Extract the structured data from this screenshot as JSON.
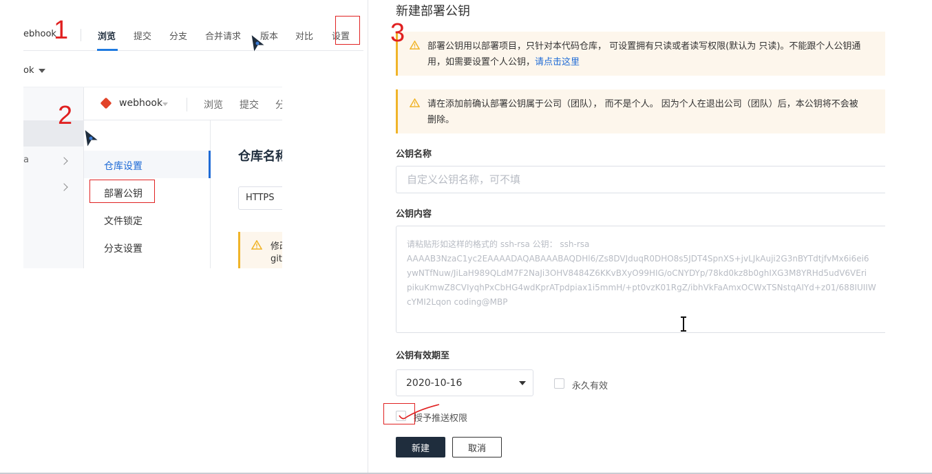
{
  "annotations": {
    "step1": "1",
    "step2": "2",
    "step3": "3"
  },
  "shot1": {
    "repo_partial": "ebhook",
    "tabs": [
      "浏览",
      "提交",
      "分支",
      "合并请求",
      "版本",
      "对比",
      "设置"
    ],
    "active_tab": "浏览",
    "repo_dropdown_partial": "ok"
  },
  "shot2": {
    "repo_name": "webhook",
    "top_tabs": [
      "浏览",
      "提交",
      "分"
    ],
    "left_partial": "a",
    "menu": [
      "仓库设置",
      "部署公钥",
      "文件锁定",
      "分支设置"
    ],
    "active_menu": "仓库设置",
    "heading_partial": "仓库名称",
    "https_label": "HTTPS",
    "warn_partial_1": "修改",
    "warn_partial_2": "git"
  },
  "dialog": {
    "title": "新建部署公钥",
    "notice1": {
      "line1": "部署公钥用以部署项目，只针对本代码仓库， 可设置拥有只读或者读写权限(默认为 只读)。不能跟个人公钥通",
      "line2_prefix": "用，如需要设置个人公钥，",
      "link": "请点击这里"
    },
    "notice2": {
      "line1": "请在添加前确认部署公钥属于公司（团队）， 而不是个人。 因为个人在退出公司（团队）后，本公钥将不会被",
      "line2": "删除。"
    },
    "name_label": "公钥名称",
    "name_placeholder": "自定义公钥名称，可不填",
    "content_label": "公钥内容",
    "content_placeholder_lines": [
      "请粘贴形如这样的格式的 ssh-rsa 公钥： ssh-rsa",
      "AAAAB3NzaC1yc2EAAAADAQABAAABAQDHl6/Zs8DVJduqR0DHO8s5JDT4SpnXS+jvLJkAuji2G3nBYTdtjfvMx6i6ei6",
      "ywNTfNuw/JiLaH989QLdM7F2NaJi3OHV8484Z6KKvBXyO99HIG/oCNYDYp/78kd0kz8b0ghIXG3M8YRHd5udV6VEri",
      "pikuKmwZ8CVIyqhPxCbHG4wdKprATpdpiax1i5mmH/+pt0vzK01RgZ/ibhVkFaAmxOCWxTSNstqAIYd+z01/688IUIIW",
      "cYMI2Lqon coding@MBP"
    ],
    "expiry_label": "公钥有效期至",
    "expiry_value": "2020-10-16",
    "forever_label": "永久有效",
    "push_label": "授予推送权限",
    "create_label": "新建",
    "cancel_label": "取消"
  }
}
